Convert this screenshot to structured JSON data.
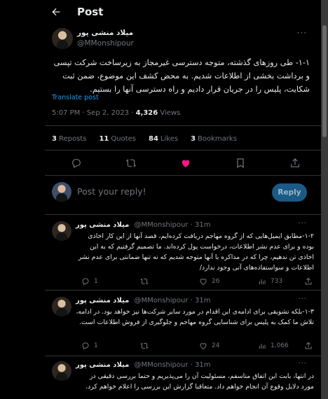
{
  "header": {
    "title": "Post"
  },
  "post": {
    "author_name": "میلاد منشی پور",
    "author_handle": "@MMonshipour",
    "text": "۱-۱- طی روزهای گذشته، متوجه دسترسی غیرمجاز به زیرساخت شرکت تپسی و برداشت بخشی از اطلاعات شدیم. به محض کشف این موضوع، ضمن ثبت شکایت، پلیس را در جریان قرار دادیم و راه دسترسی آنها را بستیم.",
    "translate_label": "Translate post",
    "time": "5:07 PM · Sep 2, 2023 · ",
    "views_count": "4,326",
    "views_label": " Views",
    "stats": {
      "reposts_count": "3",
      "reposts_label": "Reposts",
      "quotes_count": "11",
      "quotes_label": "Quotes",
      "likes_count": "84",
      "likes_label": "Likes",
      "bookmarks_count": "3",
      "bookmarks_label": "Bookmarks"
    }
  },
  "reply_box": {
    "placeholder": "Post your reply!",
    "button_label": "Reply"
  },
  "replies": [
    {
      "name": "میلاد منشی پور",
      "handle": "@MMonshipour",
      "time": "· 31m",
      "text": "۱-۲-مطابق ایمیل‌هایی که از گروه مهاجم دریافت کرده‌ایم، قصد آنها از این کار اخاذی بوده و برای عدم نشر اطلاعات، درخواست پول کرده‌اند. ما تصمیم گرفتیم که به این اخاذی تن ندهیم، چرا که در مذاکره با آنها متوجه شدیم که نه تنها ضمانتی برای عدم نشر اطلاعات و سواستفاده‌های آتی وجود ندارد/",
      "replies": "1",
      "reposts": "",
      "likes": "26",
      "views": "733"
    },
    {
      "name": "میلاد منشی پور",
      "handle": "@MMonshipour",
      "time": "· 31m",
      "text": "۱-۳-بلکه تشویقی برای ادامه‌ی این اقدام در مورد سایر شرکت‌ها نیز خواهد بود. در ادامه، تلاش ما کمک به پلیس برای شناسایی گروه مهاجم و جلوگیری از فروش اطلاعات است.",
      "replies": "1",
      "reposts": "",
      "likes": "24",
      "views": "1,066"
    },
    {
      "name": "میلاد منشی پور",
      "handle": "@MMonshipour",
      "time": "· 31m",
      "text": "در انتها، بابت این اتفاق متاسفم، مسئولیت آن را می‌پذیریم و حتما بررسی دقیقی در مورد دلایل وقوع آن انجام خواهم داد. متعاقبا گزارش این بررسی را اعلام خواهم کرد."
    }
  ],
  "colors": {
    "accent": "#1d9bf0",
    "like": "#f91880",
    "muted": "#71767b",
    "bg": "#000000"
  }
}
